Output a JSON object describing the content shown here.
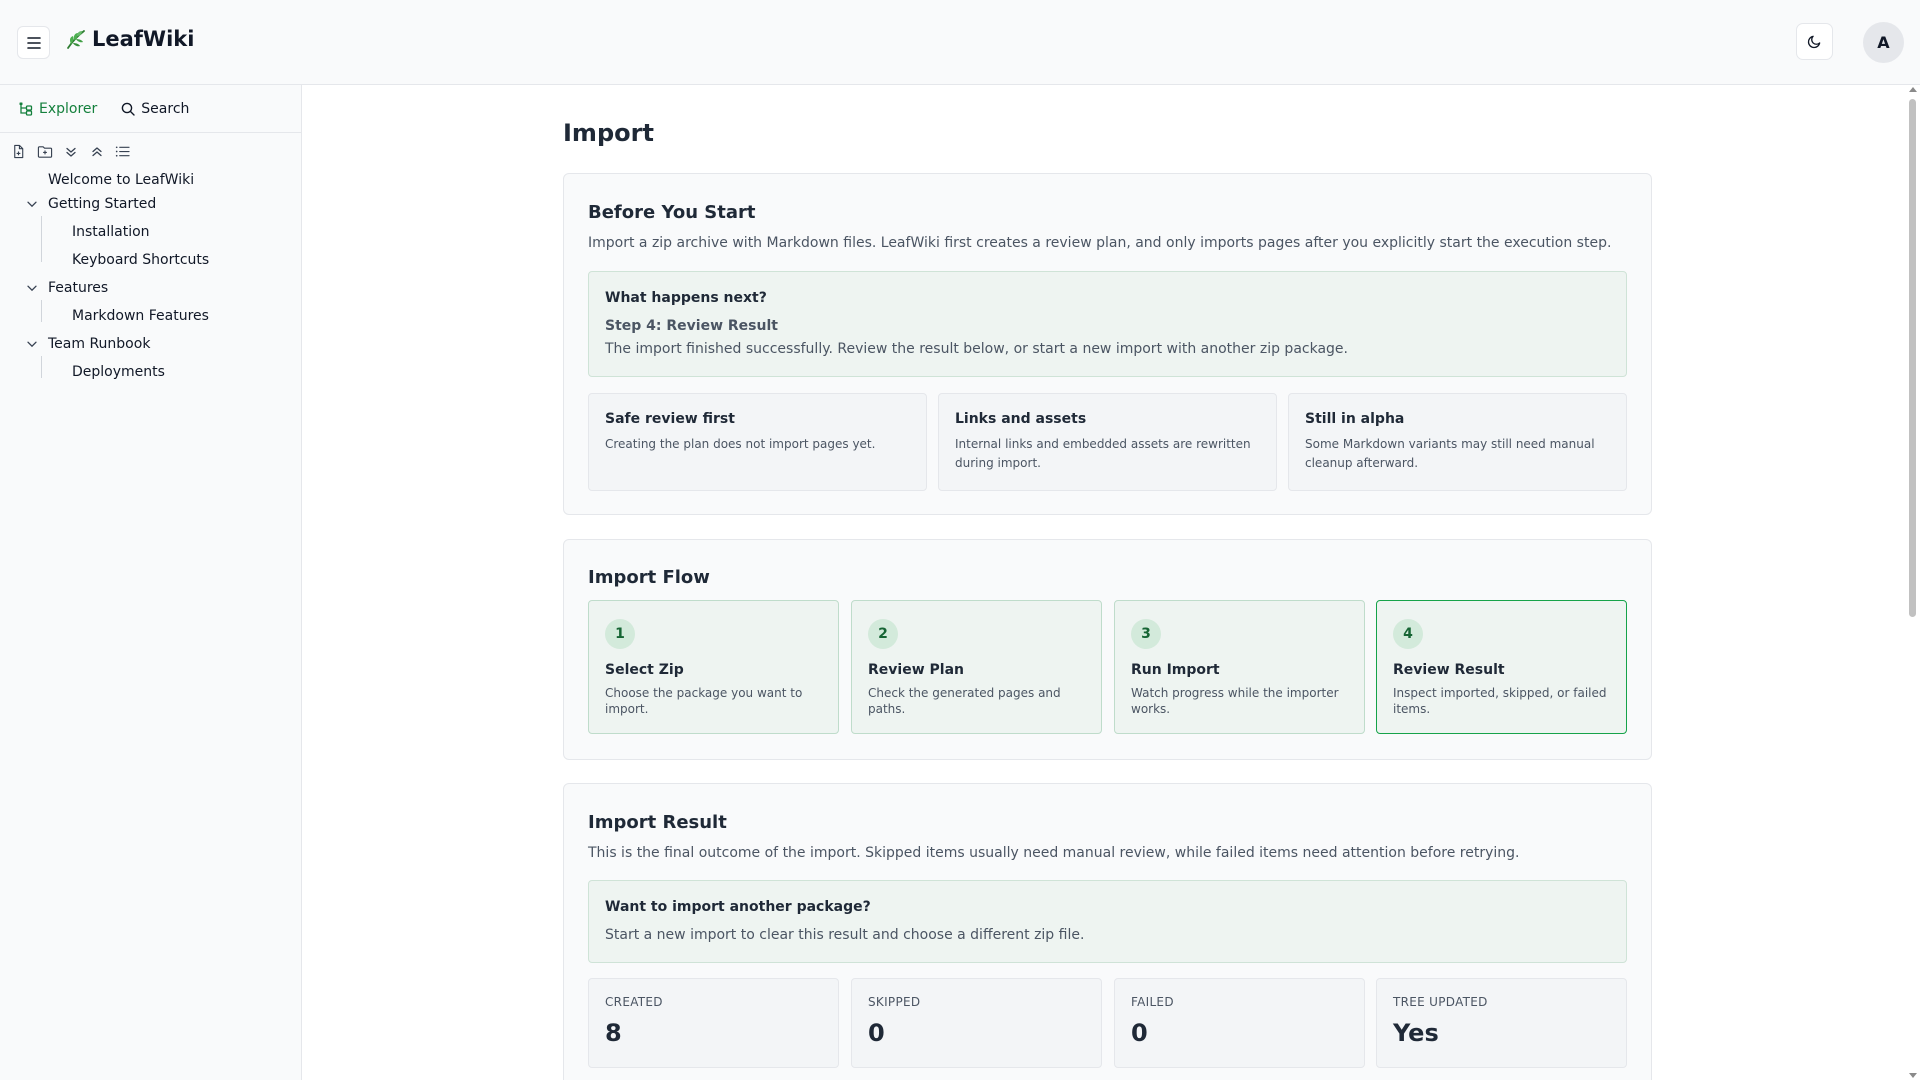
{
  "app": {
    "name": "LeafWiki",
    "avatar_initial": "A"
  },
  "sidebar": {
    "tabs": [
      {
        "label": "Explorer",
        "icon": "tree-icon"
      },
      {
        "label": "Search",
        "icon": "search-icon"
      }
    ],
    "tools": [
      "new-page-icon",
      "new-folder-icon",
      "expand-all-icon",
      "collapse-all-icon",
      "sort-list-icon"
    ],
    "tree": [
      {
        "label": "Welcome to LeafWiki",
        "level": 0,
        "expandable": false
      },
      {
        "label": "Getting Started",
        "level": 0,
        "expandable": true,
        "expanded": true
      },
      {
        "label": "Installation",
        "level": 1,
        "expandable": false
      },
      {
        "label": "Keyboard Shortcuts",
        "level": 1,
        "expandable": false
      },
      {
        "label": "Features",
        "level": 0,
        "expandable": true,
        "expanded": true
      },
      {
        "label": "Markdown Features",
        "level": 1,
        "expandable": false
      },
      {
        "label": "Team Runbook",
        "level": 0,
        "expandable": true,
        "expanded": true
      },
      {
        "label": "Deployments",
        "level": 1,
        "expandable": false
      }
    ]
  },
  "main": {
    "title": "Import",
    "before": {
      "title": "Before You Start",
      "description": "Import a zip archive with Markdown files. LeafWiki first creates a review plan, and only imports pages after you explicitly start the execution step.",
      "next": {
        "title": "What happens next?",
        "step": "Step 4: Review Result",
        "text": "The import finished successfully. Review the result below, or start a new import with another zip package."
      },
      "info": [
        {
          "title": "Safe review first",
          "text": "Creating the plan does not import pages yet."
        },
        {
          "title": "Links and assets",
          "text": "Internal links and embedded assets are rewritten during import."
        },
        {
          "title": "Still in alpha",
          "text": "Some Markdown variants may still need manual cleanup afterward."
        }
      ]
    },
    "flow": {
      "title": "Import Flow",
      "current_step": 4,
      "steps": [
        {
          "num": "1",
          "title": "Select Zip",
          "text": "Choose the package you want to import."
        },
        {
          "num": "2",
          "title": "Review Plan",
          "text": "Check the generated pages and paths."
        },
        {
          "num": "3",
          "title": "Run Import",
          "text": "Watch progress while the importer works."
        },
        {
          "num": "4",
          "title": "Review Result",
          "text": "Inspect imported, skipped, or failed items."
        }
      ]
    },
    "result": {
      "title": "Import Result",
      "description": "This is the final outcome of the import. Skipped items usually need manual review, while failed items need attention before retrying.",
      "another": {
        "title": "Want to import another package?",
        "text": "Start a new import to clear this result and choose a different zip file."
      },
      "stats": [
        {
          "label": "CREATED",
          "value": "8"
        },
        {
          "label": "SKIPPED",
          "value": "0"
        },
        {
          "label": "FAILED",
          "value": "0"
        },
        {
          "label": "TREE UPDATED",
          "value": "Yes"
        }
      ]
    }
  },
  "colors": {
    "accent": "#16a34a",
    "accent_text": "#15803d",
    "note_bg": "#eef4f1"
  }
}
